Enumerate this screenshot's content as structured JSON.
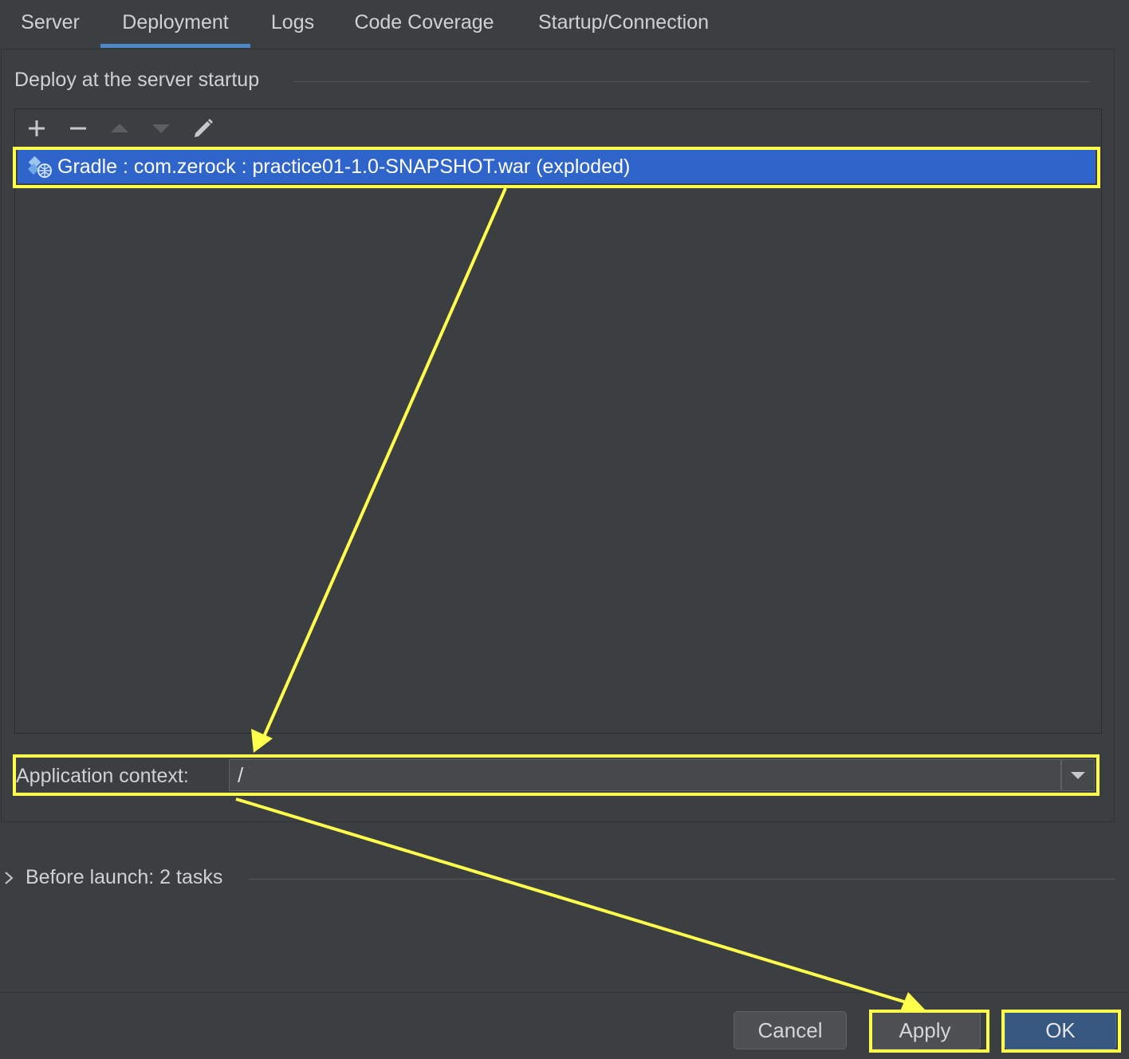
{
  "tabs": [
    {
      "label": "Server",
      "active": false
    },
    {
      "label": "Deployment",
      "active": true
    },
    {
      "label": "Logs",
      "active": false
    },
    {
      "label": "Code Coverage",
      "active": false
    },
    {
      "label": "Startup/Connection",
      "active": false
    }
  ],
  "deploy": {
    "title": "Deploy at the server startup",
    "toolbar": {
      "add": "+",
      "remove": "−",
      "move_up": "▲",
      "move_down": "▼",
      "edit": "✎"
    },
    "items": [
      {
        "label": "Gradle : com.zerock : practice01-1.0-SNAPSHOT.war (exploded)",
        "selected": true,
        "icon": "artifact-icon"
      }
    ]
  },
  "context": {
    "label": "Application context:",
    "value": "/"
  },
  "before_launch": {
    "label": "Before launch: 2 tasks",
    "expanded": false
  },
  "buttons": {
    "cancel": "Cancel",
    "apply": "Apply",
    "ok": "OK"
  },
  "colors": {
    "background": "#3c3f41",
    "selection": "#2f65ca",
    "tab_underline": "#4a88c7",
    "annotation": "#ffff4c",
    "ok_button": "#365880"
  }
}
